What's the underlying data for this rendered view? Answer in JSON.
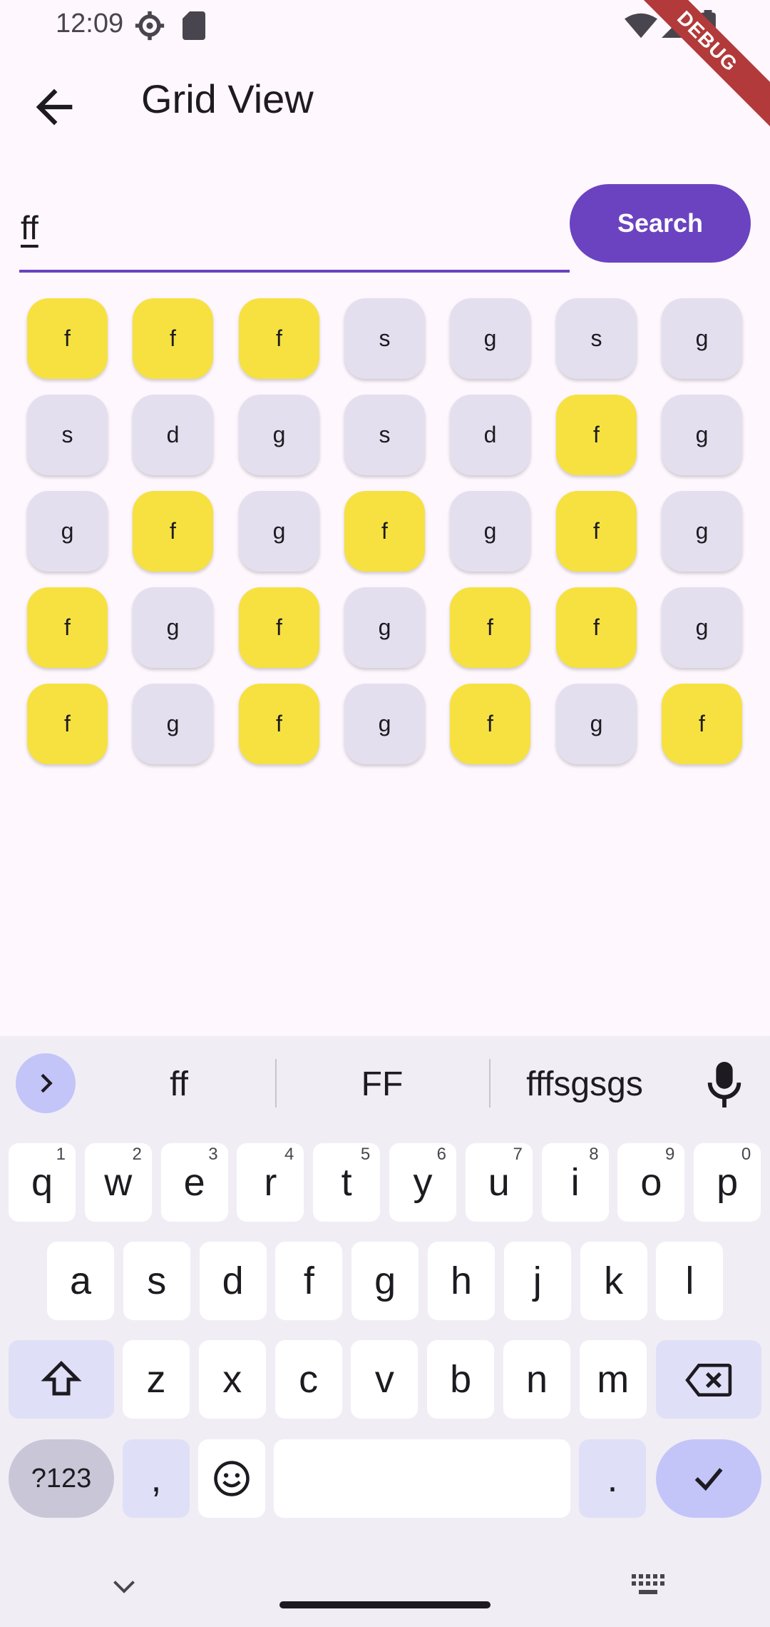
{
  "status": {
    "time": "12:09",
    "debug_label": "DEBUG"
  },
  "app_bar": {
    "title": "Grid View"
  },
  "search": {
    "value": "ff",
    "button_label": "Search"
  },
  "grid": {
    "columns": 7,
    "cells": [
      {
        "letter": "f",
        "highlighted": true
      },
      {
        "letter": "f",
        "highlighted": true
      },
      {
        "letter": "f",
        "highlighted": true
      },
      {
        "letter": "s",
        "highlighted": false
      },
      {
        "letter": "g",
        "highlighted": false
      },
      {
        "letter": "s",
        "highlighted": false
      },
      {
        "letter": "g",
        "highlighted": false
      },
      {
        "letter": "s",
        "highlighted": false
      },
      {
        "letter": "d",
        "highlighted": false
      },
      {
        "letter": "g",
        "highlighted": false
      },
      {
        "letter": "s",
        "highlighted": false
      },
      {
        "letter": "d",
        "highlighted": false
      },
      {
        "letter": "f",
        "highlighted": true
      },
      {
        "letter": "g",
        "highlighted": false
      },
      {
        "letter": "g",
        "highlighted": false
      },
      {
        "letter": "f",
        "highlighted": true
      },
      {
        "letter": "g",
        "highlighted": false
      },
      {
        "letter": "f",
        "highlighted": true
      },
      {
        "letter": "g",
        "highlighted": false
      },
      {
        "letter": "f",
        "highlighted": true
      },
      {
        "letter": "g",
        "highlighted": false
      },
      {
        "letter": "f",
        "highlighted": true
      },
      {
        "letter": "g",
        "highlighted": false
      },
      {
        "letter": "f",
        "highlighted": true
      },
      {
        "letter": "g",
        "highlighted": false
      },
      {
        "letter": "f",
        "highlighted": true
      },
      {
        "letter": "f",
        "highlighted": true
      },
      {
        "letter": "g",
        "highlighted": false
      },
      {
        "letter": "f",
        "highlighted": true
      },
      {
        "letter": "g",
        "highlighted": false
      },
      {
        "letter": "f",
        "highlighted": true
      },
      {
        "letter": "g",
        "highlighted": false
      },
      {
        "letter": "f",
        "highlighted": true
      },
      {
        "letter": "g",
        "highlighted": false
      },
      {
        "letter": "f",
        "highlighted": true
      }
    ]
  },
  "keyboard": {
    "suggestions": [
      "ff",
      "FF",
      "fffsgsgs"
    ],
    "row1": [
      {
        "key": "q",
        "hint": "1"
      },
      {
        "key": "w",
        "hint": "2"
      },
      {
        "key": "e",
        "hint": "3"
      },
      {
        "key": "r",
        "hint": "4"
      },
      {
        "key": "t",
        "hint": "5"
      },
      {
        "key": "y",
        "hint": "6"
      },
      {
        "key": "u",
        "hint": "7"
      },
      {
        "key": "i",
        "hint": "8"
      },
      {
        "key": "o",
        "hint": "9"
      },
      {
        "key": "p",
        "hint": "0"
      }
    ],
    "row2": [
      "a",
      "s",
      "d",
      "f",
      "g",
      "h",
      "j",
      "k",
      "l"
    ],
    "row3": [
      "z",
      "x",
      "c",
      "v",
      "b",
      "n",
      "m"
    ],
    "symbols_label": "?123",
    "comma_label": ",",
    "period_label": "."
  },
  "colors": {
    "accent": "#6b43c0",
    "highlight": "#f6e141",
    "cell_default": "#e4dfee",
    "background": "#fef7fd"
  },
  "icons": [
    "settings-icon",
    "sd-card-icon",
    "wifi-icon",
    "signal-icon",
    "battery-icon",
    "back-arrow-icon",
    "chevron-right-icon",
    "mic-icon",
    "shift-icon",
    "backspace-icon",
    "emoji-icon",
    "check-icon",
    "chevron-down-icon",
    "keyboard-icon"
  ]
}
